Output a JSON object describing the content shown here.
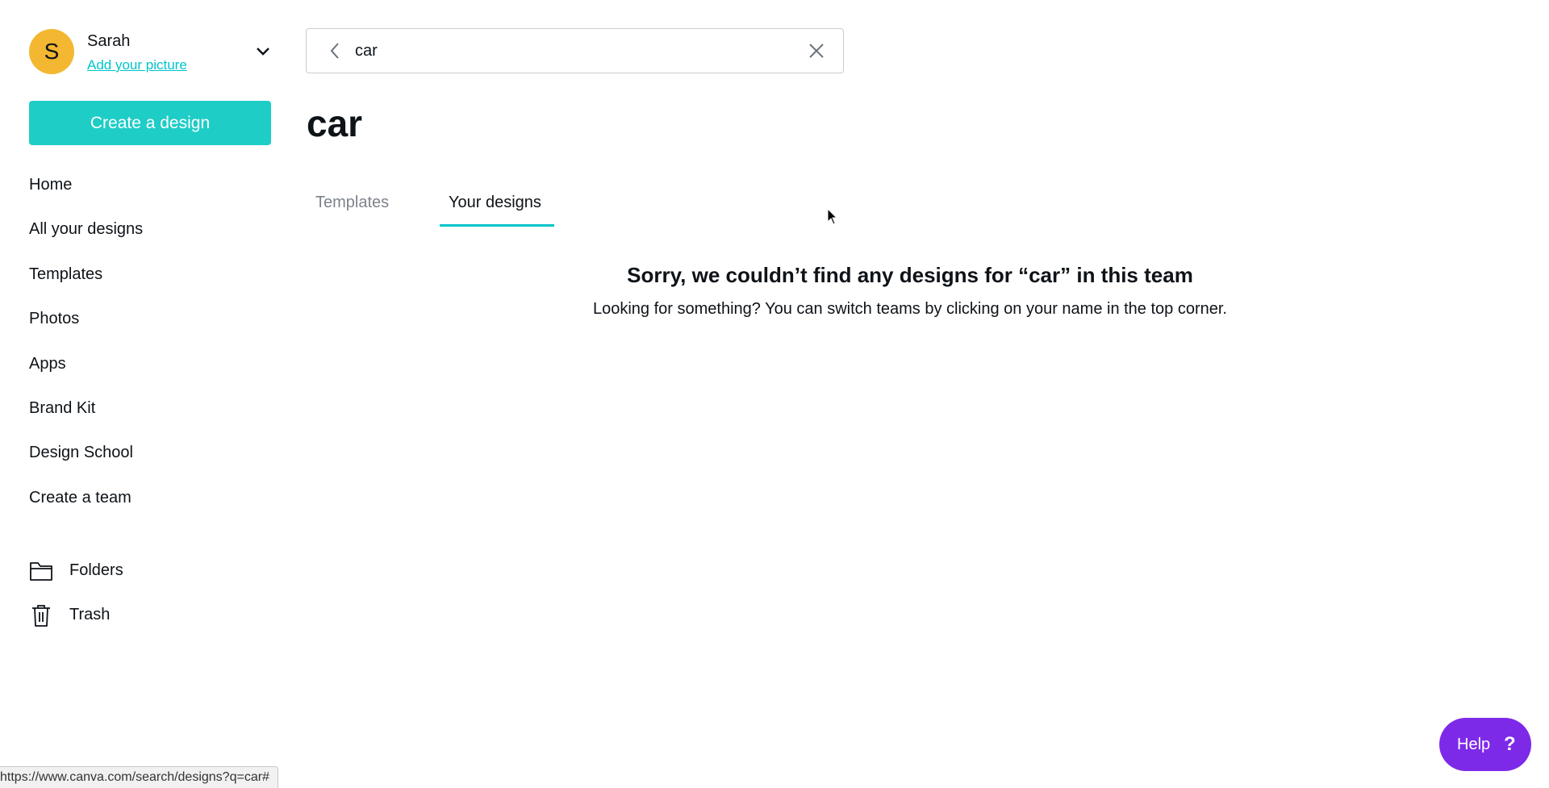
{
  "account": {
    "initial": "S",
    "name": "Sarah",
    "add_picture_link": "Add your picture",
    "avatar_color": "#f3b731"
  },
  "sidebar": {
    "create_button": "Create a design",
    "items": [
      {
        "label": "Home"
      },
      {
        "label": "All your designs"
      },
      {
        "label": "Templates"
      },
      {
        "label": "Photos"
      },
      {
        "label": "Apps"
      },
      {
        "label": "Brand Kit"
      },
      {
        "label": "Design School"
      },
      {
        "label": "Create a team"
      }
    ],
    "folders_label": "Folders",
    "trash_label": "Trash"
  },
  "search": {
    "value": "car",
    "back_icon": "chevron-left-icon",
    "clear_icon": "close-icon"
  },
  "main": {
    "title": "car",
    "tabs": [
      {
        "label": "Templates",
        "active": false
      },
      {
        "label": "Your designs",
        "active": true
      }
    ],
    "empty_title": "Sorry, we couldn’t find any designs for “car” in this team",
    "empty_message": "Looking for something? You can switch teams by clicking on your name in the top corner."
  },
  "help": {
    "label": "Help",
    "icon": "?"
  },
  "status_bar": {
    "url": "https://www.canva.com/search/designs?q=car#"
  },
  "colors": {
    "accent": "#00c4cc",
    "create_button": "#1ecdc6",
    "help_button": "#7d2ae8",
    "text": "#0e1318",
    "muted_text": "#7d838a"
  }
}
